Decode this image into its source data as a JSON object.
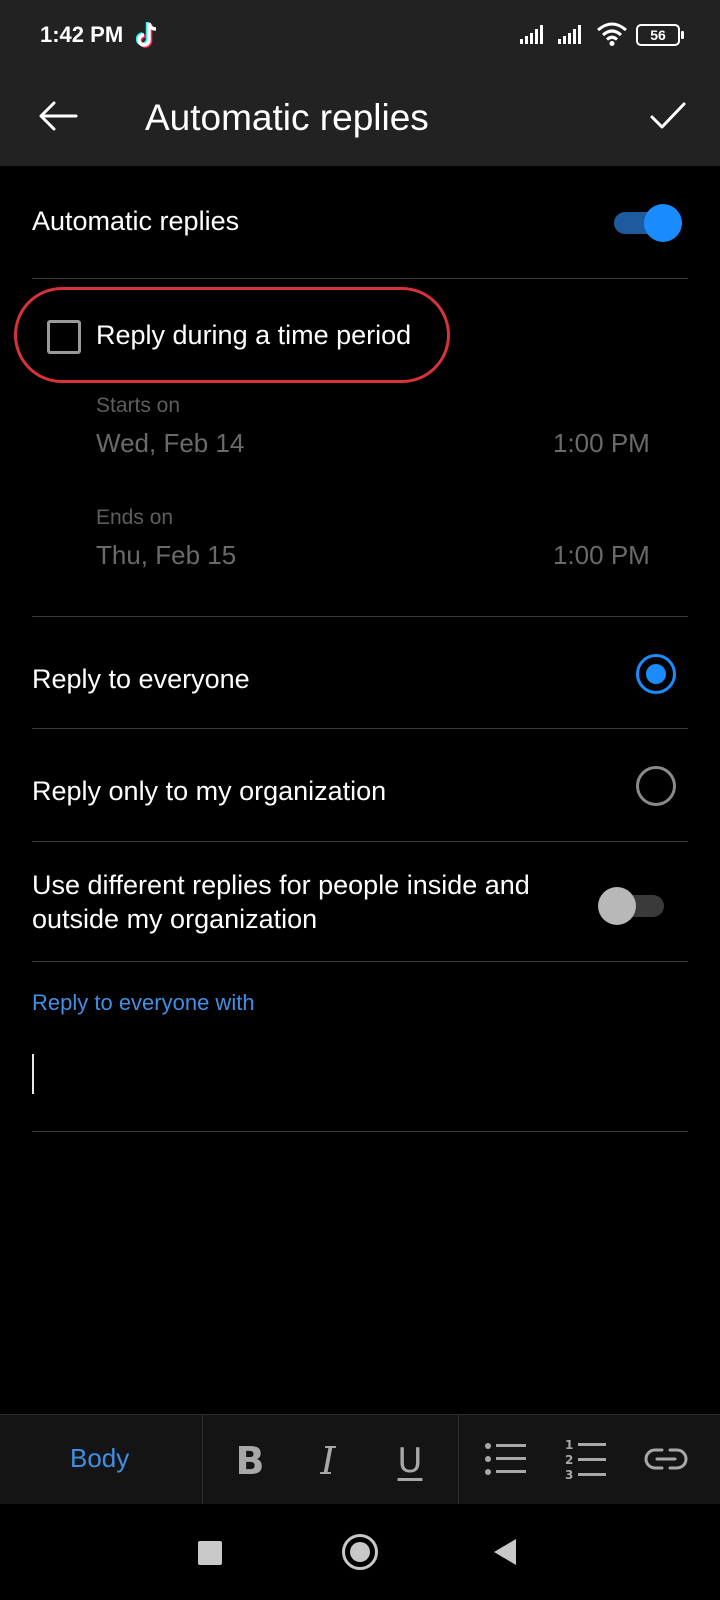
{
  "status_bar": {
    "time": "1:42 PM",
    "app_icon": "tiktok-icon",
    "battery": "56"
  },
  "header": {
    "title": "Automatic replies",
    "back_icon": "arrow-left-icon",
    "confirm_icon": "checkmark-icon"
  },
  "settings": {
    "auto_replies": {
      "label": "Automatic replies",
      "enabled": true
    },
    "time_period": {
      "label": "Reply during a time period",
      "checked": false,
      "starts_label": "Starts on",
      "starts_date": "Wed, Feb 14",
      "starts_time": "1:00 PM",
      "ends_label": "Ends on",
      "ends_date": "Thu, Feb 15",
      "ends_time": "1:00 PM"
    },
    "audience": {
      "everyone": {
        "label": "Reply to everyone",
        "selected": true
      },
      "organization": {
        "label": "Reply only to my organization",
        "selected": false
      }
    },
    "different_replies": {
      "line1": "Use different replies for people inside and",
      "line2": "outside my organization",
      "enabled": false
    },
    "reply_message": {
      "label": "Reply to everyone with",
      "value": ""
    }
  },
  "format_toolbar": {
    "style_label": "Body",
    "bold": "B",
    "italic": "I",
    "underline": "U",
    "icons": [
      "bulleted-list-icon",
      "numbered-list-icon",
      "link-icon"
    ]
  },
  "nav_bar": {
    "icons": [
      "recents-square-icon",
      "home-circle-icon",
      "back-triangle-icon"
    ]
  },
  "colors": {
    "accent": "#1a8cff",
    "highlight_outline": "#d8323a",
    "header_bg": "#222222",
    "background": "#000000"
  }
}
